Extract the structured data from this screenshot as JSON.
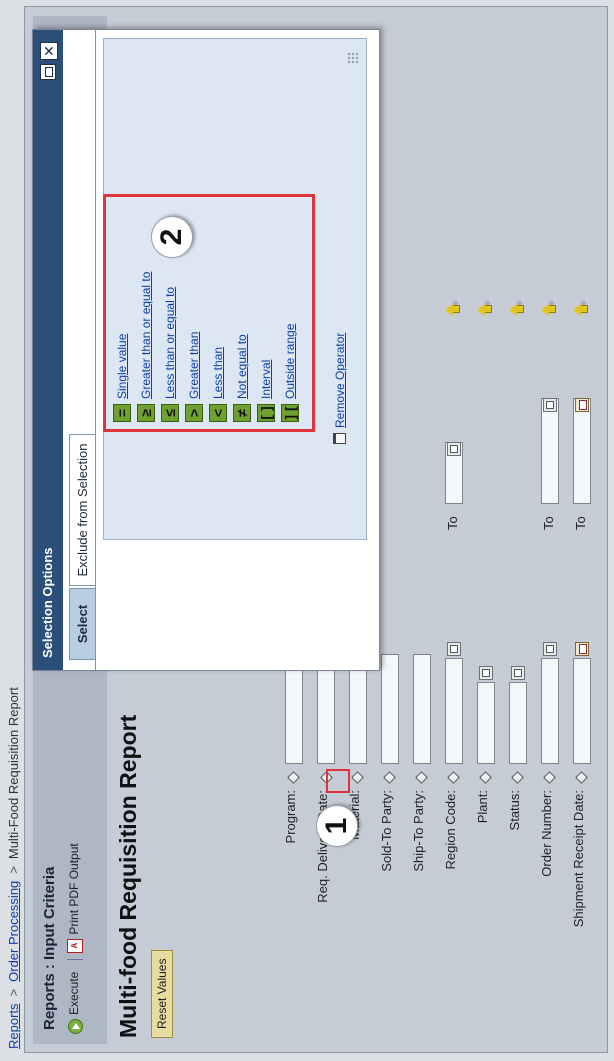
{
  "breadcrumbs": [
    "Reports",
    "Order Processing",
    "Multi-Food Requisition Report"
  ],
  "breadcrumb_separator": ">",
  "page": {
    "header_title": "Reports : Input Criteria",
    "toolbar": {
      "execute": "Execute",
      "print_pdf": "Print PDF Output"
    },
    "report_title": "Multi-food Requisition Report",
    "reset_button": "Reset Values",
    "to_label": "To"
  },
  "fields": [
    {
      "label": "Program:"
    },
    {
      "label": "Req. Delivery Date:"
    },
    {
      "label": "Material:"
    },
    {
      "label": "Sold-To Party:"
    },
    {
      "label": "Ship-To Party:"
    },
    {
      "label": "Region Code:"
    },
    {
      "label": "Plant:"
    },
    {
      "label": "Status:"
    },
    {
      "label": "Order Number:"
    },
    {
      "label": "Shipment Receipt Date:"
    }
  ],
  "dialog": {
    "title": "Selection Options",
    "close_symbol": "✕",
    "tabs": [
      "Select",
      "Exclude from Selection"
    ],
    "options": [
      {
        "symbol": "=",
        "label": "Single value"
      },
      {
        "symbol": "≥",
        "label": "Greater than or equal to"
      },
      {
        "symbol": "≤",
        "label": "Less than or equal to"
      },
      {
        "symbol": ">",
        "label": "Greater than"
      },
      {
        "symbol": "<",
        "label": "Less than"
      },
      {
        "symbol": "≠",
        "label": "Not equal to"
      },
      {
        "symbol": "[ ]",
        "label": "Interval"
      },
      {
        "symbol": "] [",
        "label": "Outside range"
      }
    ],
    "remove_operator": "Remove Operator"
  },
  "callouts": [
    "1",
    "2"
  ],
  "colors": {
    "highlight": "#e0323a",
    "dialog_titlebar": "#2c4f7a",
    "operator_green": "#6fa032",
    "multi_select_arrow": "#e0c51c"
  }
}
